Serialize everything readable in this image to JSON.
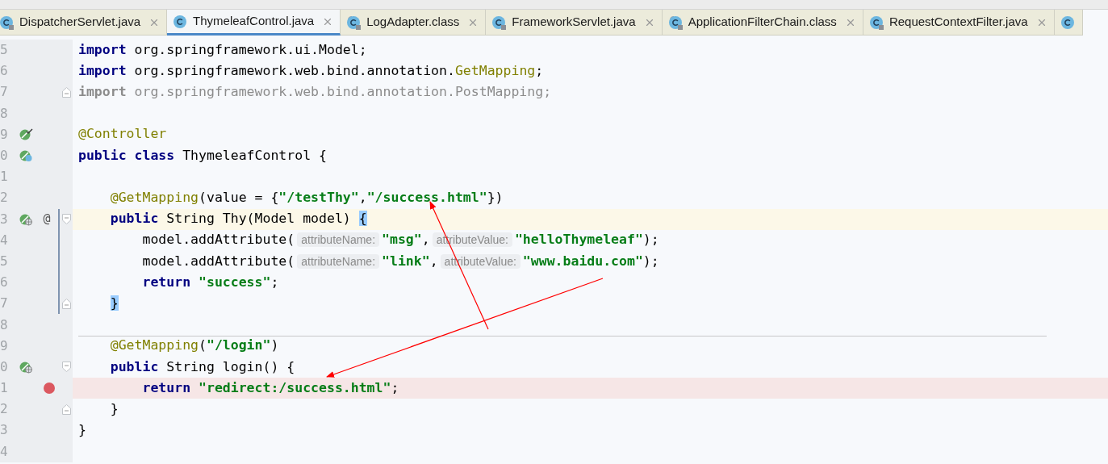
{
  "tabs": [
    {
      "label": "DispatcherServlet.java",
      "selected": false,
      "read_only": true,
      "compiled": false
    },
    {
      "label": "ThymeleafControl.java",
      "selected": true,
      "read_only": false,
      "compiled": false
    },
    {
      "label": "LogAdapter.class",
      "selected": false,
      "read_only": true,
      "compiled": true
    },
    {
      "label": "FrameworkServlet.java",
      "selected": false,
      "read_only": true,
      "compiled": false
    },
    {
      "label": "ApplicationFilterChain.class",
      "selected": false,
      "read_only": true,
      "compiled": true
    },
    {
      "label": "RequestContextFilter.java",
      "selected": false,
      "read_only": true,
      "compiled": false
    },
    {
      "selected": false,
      "read_only": false,
      "compiled": false
    }
  ],
  "lines": [
    {
      "number": "5",
      "current": false,
      "breakpoint": false,
      "changed": false,
      "tokens": [
        {
          "kind": "kw",
          "text": "import"
        },
        {
          "kind": "plain",
          "text": " org.springframework.ui.Model;"
        }
      ]
    },
    {
      "number": "6",
      "current": false,
      "breakpoint": false,
      "changed": false,
      "tokens": [
        {
          "kind": "kw",
          "text": "import"
        },
        {
          "kind": "plain",
          "text": " org.springframework.web.bind.annotation."
        },
        {
          "kind": "ann",
          "text": "GetMapping"
        },
        {
          "kind": "plain",
          "text": ";"
        }
      ]
    },
    {
      "number": "7",
      "current": false,
      "breakpoint": false,
      "changed": false,
      "fold": {
        "kind": "end"
      },
      "tokens": [
        {
          "kind": "dimkw",
          "text": "import"
        },
        {
          "kind": "dim",
          "text": " org.springframework.web.bind.annotation.PostMapping;"
        }
      ]
    },
    {
      "number": "8",
      "current": false,
      "breakpoint": false,
      "changed": false
    },
    {
      "number": "9",
      "current": false,
      "breakpoint": false,
      "changed": false,
      "marker": {
        "kind": "bean-check"
      },
      "tokens": [
        {
          "kind": "ann",
          "text": "@Controller"
        }
      ]
    },
    {
      "number": "0",
      "current": false,
      "breakpoint": false,
      "changed": false,
      "marker": {
        "kind": "bean-class"
      },
      "tokens": [
        {
          "kind": "kw",
          "text": "public class"
        },
        {
          "kind": "plain",
          "text": " ThymeleafControl {"
        }
      ]
    },
    {
      "number": "1",
      "current": false,
      "breakpoint": false,
      "changed": false
    },
    {
      "number": "2",
      "current": false,
      "breakpoint": false,
      "changed": false,
      "tokens": [
        {
          "kind": "ann",
          "text": "    @GetMapping"
        },
        {
          "kind": "plain",
          "text": "(value = {"
        },
        {
          "kind": "str",
          "text": "\"/testThy\""
        },
        {
          "kind": "plain",
          "text": ","
        },
        {
          "kind": "str",
          "text": "\"/success.html\""
        },
        {
          "kind": "plain",
          "text": "})"
        }
      ]
    },
    {
      "number": "3",
      "current": true,
      "breakpoint": false,
      "changed": true,
      "marker": {
        "kind": "bean-web"
      },
      "mapping": "@",
      "fold": {
        "kind": "start"
      },
      "tokens": [
        {
          "kind": "kw",
          "text": "    public"
        },
        {
          "kind": "plain",
          "text": " String Thy(Model model) "
        },
        {
          "kind": "brace",
          "text": "{"
        }
      ]
    },
    {
      "number": "4",
      "current": false,
      "breakpoint": false,
      "changed": true,
      "tokens": [
        {
          "kind": "plain",
          "text": "        model.addAttribute("
        },
        {
          "kind": "hint",
          "text": "attributeName:"
        },
        {
          "kind": "str",
          "text": "\"msg\""
        },
        {
          "kind": "plain",
          "text": ","
        },
        {
          "kind": "hint",
          "text": "attributeValue:"
        },
        {
          "kind": "str",
          "text": "\"helloThymeleaf\""
        },
        {
          "kind": "plain",
          "text": ");"
        }
      ]
    },
    {
      "number": "5",
      "current": false,
      "breakpoint": false,
      "changed": true,
      "tokens": [
        {
          "kind": "plain",
          "text": "        model.addAttribute("
        },
        {
          "kind": "hint",
          "text": "attributeName:"
        },
        {
          "kind": "str",
          "text": "\"link\""
        },
        {
          "kind": "plain",
          "text": ","
        },
        {
          "kind": "hint",
          "text": "attributeValue:"
        },
        {
          "kind": "str",
          "text": "\"www.baidu.com\""
        },
        {
          "kind": "plain",
          "text": ");"
        }
      ]
    },
    {
      "number": "6",
      "current": false,
      "breakpoint": false,
      "changed": true,
      "tokens": [
        {
          "kind": "kw",
          "text": "        return"
        },
        {
          "kind": "str",
          "text": " \"success\""
        },
        {
          "kind": "plain",
          "text": ";"
        }
      ]
    },
    {
      "number": "7",
      "current": false,
      "breakpoint": false,
      "changed": true,
      "fold": {
        "kind": "end"
      },
      "tokens": [
        {
          "kind": "brace",
          "text": "    }"
        }
      ]
    },
    {
      "number": "8",
      "current": false,
      "breakpoint": false,
      "changed": false
    },
    {
      "number": "9",
      "current": false,
      "breakpoint": false,
      "changed": false,
      "separator": true,
      "tokens": [
        {
          "kind": "ann",
          "text": "    @GetMapping"
        },
        {
          "kind": "plain",
          "text": "("
        },
        {
          "kind": "str",
          "text": "\"/login\""
        },
        {
          "kind": "plain",
          "text": ")"
        }
      ]
    },
    {
      "number": "0",
      "current": false,
      "breakpoint": false,
      "changed": false,
      "marker": {
        "kind": "bean-web"
      },
      "fold": {
        "kind": "start"
      },
      "tokens": [
        {
          "kind": "kw",
          "text": "    public"
        },
        {
          "kind": "plain",
          "text": " String login() {"
        }
      ]
    },
    {
      "number": "1",
      "current": false,
      "breakpoint": true,
      "changed": false,
      "tokens": [
        {
          "kind": "kw",
          "text": "        return"
        },
        {
          "kind": "str",
          "text": " \"redirect:/success.html\""
        },
        {
          "kind": "plain",
          "text": ";"
        }
      ]
    },
    {
      "number": "2",
      "current": false,
      "breakpoint": false,
      "changed": false,
      "fold": {
        "kind": "end"
      },
      "tokens": [
        {
          "kind": "plain",
          "text": "    }"
        }
      ]
    },
    {
      "number": "3",
      "current": false,
      "breakpoint": false,
      "changed": false,
      "tokens": [
        {
          "kind": "plain",
          "text": "}"
        }
      ]
    },
    {
      "number": "4",
      "current": false,
      "breakpoint": false,
      "changed": false
    }
  ],
  "annotations": [
    {
      "kind": "arrow"
    },
    {
      "kind": "arrow"
    }
  ]
}
